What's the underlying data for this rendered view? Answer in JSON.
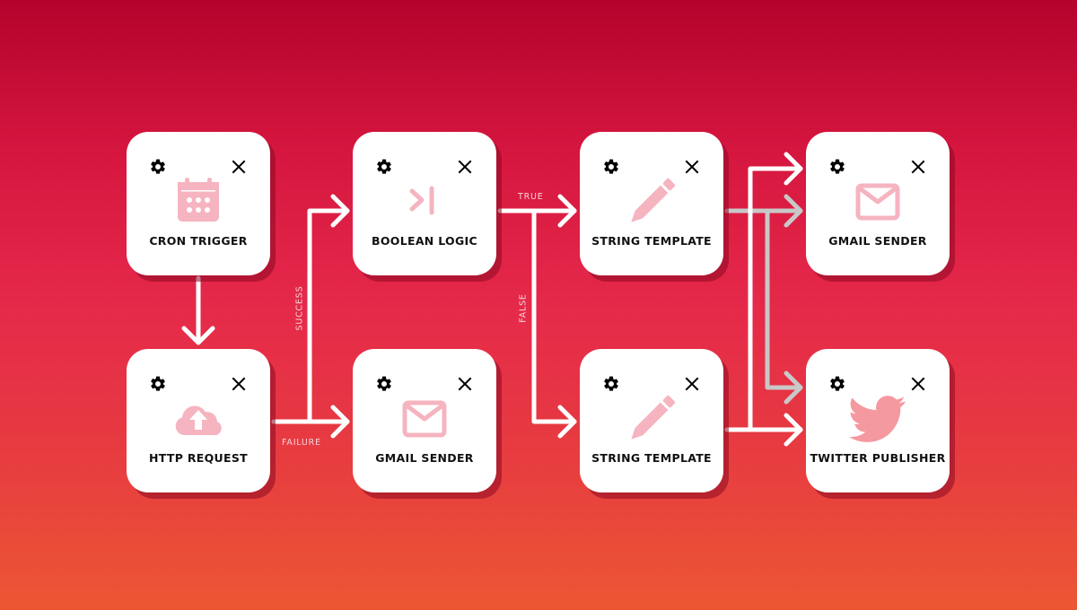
{
  "diagram": {
    "background": {
      "top": "#b3032c",
      "bottom": "#ec5733"
    },
    "colors": {
      "icon": "#f5b4c0",
      "twitter_icon": "#f4999f",
      "wire_primary": "#ffffff",
      "wire_secondary": "#c8c8c8",
      "edge_label": "#f7d3d8"
    },
    "nodes": [
      {
        "id": "cron",
        "label": "Cron Trigger",
        "icon": "calendar-icon"
      },
      {
        "id": "boolean",
        "label": "Boolean Logic",
        "icon": "boolean-logic-icon"
      },
      {
        "id": "string1",
        "label": "String Template",
        "icon": "pencil-icon"
      },
      {
        "id": "gmail2",
        "label": "Gmail Sender",
        "icon": "envelope-icon"
      },
      {
        "id": "http",
        "label": "HTTP Request",
        "icon": "cloud-upload-icon"
      },
      {
        "id": "gmail1",
        "label": "Gmail Sender",
        "icon": "envelope-icon"
      },
      {
        "id": "string2",
        "label": "String Template",
        "icon": "pencil-icon"
      },
      {
        "id": "twitter",
        "label": "Twitter Publisher",
        "icon": "twitter-bird-icon"
      }
    ],
    "edges": [
      {
        "from": "cron",
        "to": "http",
        "label": ""
      },
      {
        "from": "http",
        "to": "boolean",
        "label": "Success"
      },
      {
        "from": "http",
        "to": "gmail1",
        "label": "Failure"
      },
      {
        "from": "boolean",
        "to": "string1",
        "label": "True"
      },
      {
        "from": "boolean",
        "to": "string2",
        "label": "False"
      },
      {
        "from": "string1",
        "to": "gmail2",
        "label": ""
      },
      {
        "from": "string1",
        "to": "twitter",
        "label": ""
      },
      {
        "from": "string2",
        "to": "gmail2",
        "label": ""
      },
      {
        "from": "string2",
        "to": "twitter",
        "label": ""
      }
    ],
    "edge_labels": {
      "success": "Success",
      "failure": "Failure",
      "true": "True",
      "false": "False"
    },
    "card_controls": {
      "settings": "gear-icon",
      "remove": "close-icon"
    }
  }
}
